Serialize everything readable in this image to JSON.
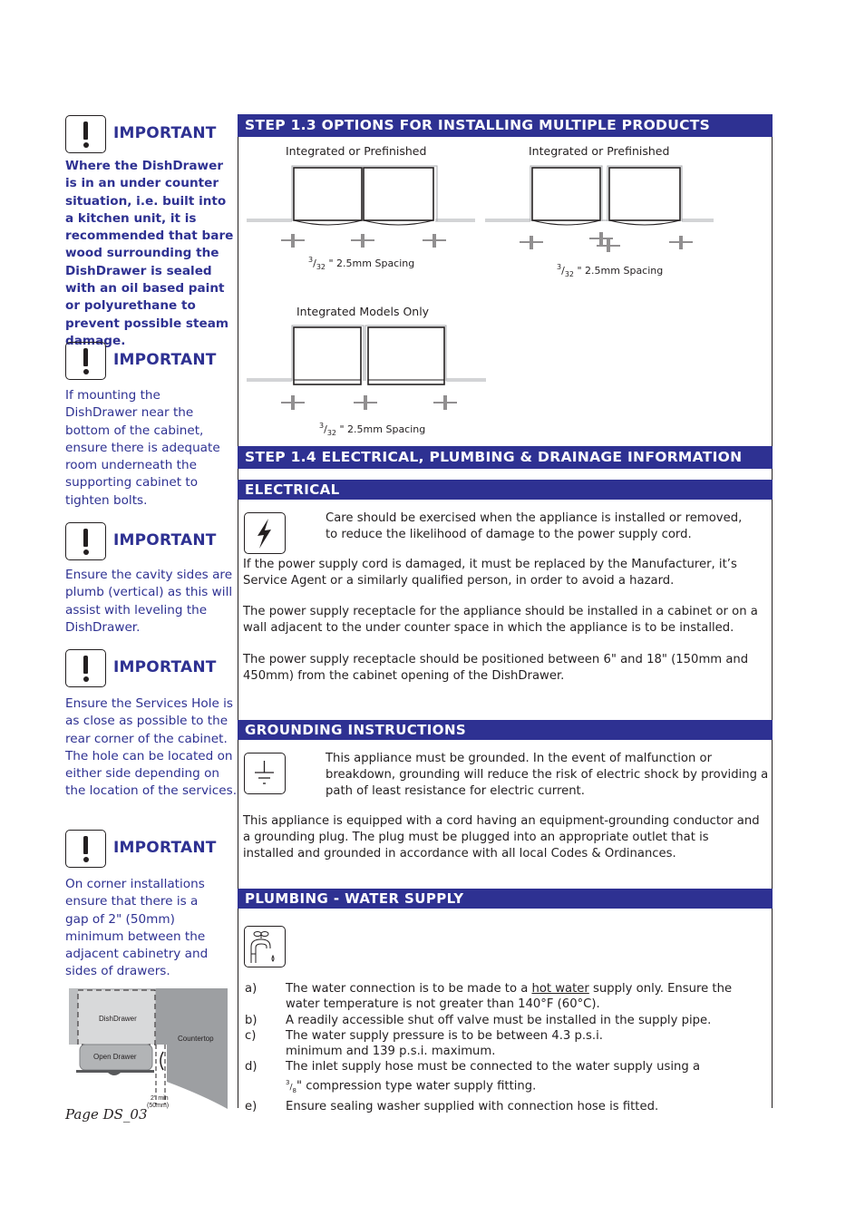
{
  "sidebar": {
    "notes": [
      {
        "title": "IMPORTANT",
        "icon": "exclamation-icon",
        "text": "Where the DishDrawer is in an under counter situation, i.e. built into a kitchen unit, it is recommended that bare wood surrounding the DishDrawer is sealed with an oil based paint or polyurethane to prevent possible steam damage."
      },
      {
        "title": "IMPORTANT",
        "icon": "exclamation-icon",
        "text": "If mounting the DishDrawer near the bottom of the cabinet, ensure there is adequate room underneath the supporting cabinet to tighten bolts."
      },
      {
        "title": "IMPORTANT",
        "icon": "exclamation-icon",
        "text": "Ensure the cavity sides are plumb (vertical) as this will assist with leveling the DishDrawer."
      },
      {
        "title": "IMPORTANT",
        "icon": "exclamation-icon",
        "text": "Ensure the Services Hole is as close as possible to the rear corner of the cabinet. The hole can be located on either side depending on the location of the services."
      },
      {
        "title": "IMPORTANT",
        "icon": "exclamation-icon",
        "text": "On corner installations ensure that there is a gap of 2\" (50mm) minimum between the adjacent cabinetry and sides of drawers."
      }
    ],
    "corner_diagram": {
      "dishdrawer_label": "DishDrawer",
      "countertop_label": "Countertop",
      "open_drawer_label": "Open Drawer",
      "gap_label_1": "2\" min",
      "gap_label_2": "(50mm)"
    },
    "page_number": "Page DS_03"
  },
  "step13": {
    "heading": "STEP  1.3  OPTIONS FOR INSTALLING MULTIPLE PRODUCTS",
    "diagrams": [
      {
        "label": "Integrated or Prefinished",
        "spacing_num": "3",
        "spacing_den": "32",
        "spacing_text": " \" 2.5mm Spacing"
      },
      {
        "label": "Integrated or Prefinished",
        "spacing_num": "3",
        "spacing_den": "32",
        "spacing_text": " \" 2.5mm Spacing"
      },
      {
        "label": "Integrated Models Only",
        "spacing_num": "3",
        "spacing_den": "32",
        "spacing_text": " \" 2.5mm Spacing"
      }
    ]
  },
  "step14": {
    "heading": "STEP  1.4  ELECTRICAL, PLUMBING & DRAINAGE INFORMATION",
    "electrical": {
      "heading": "ELECTRICAL",
      "icon": "lightning-icon",
      "intro": "Care should be exercised when the appliance is installed or removed, to reduce the likelihood of damage to the power supply cord.",
      "paragraphs": [
        "If the power supply cord is damaged, it must be replaced by the Manufacturer, it’s Service Agent or a similarly qualified person, in order to avoid a hazard.",
        "The power supply receptacle for the appliance should be installed in a cabinet or on a wall adjacent to the under counter space in which the appliance is to be installed.",
        "The power supply receptacle should be positioned between 6\" and 18\" (150mm and 450mm) from the cabinet opening of the DishDrawer."
      ]
    },
    "grounding": {
      "heading": "GROUNDING  INSTRUCTIONS",
      "icon": "ground-icon",
      "intro": "This appliance must be grounded.  In the event of malfunction or breakdown, grounding will reduce the risk of electric shock by providing a path of least resistance for electric current.",
      "paragraph": "This appliance is equipped with a cord having an equipment-grounding conductor and a grounding plug.  The plug must be plugged into an appropriate outlet that is installed and grounded in accordance with all local Codes & Ordinances."
    },
    "plumbing": {
      "heading": "PLUMBING  -  WATER  SUPPLY",
      "icon": "faucet-icon",
      "items": [
        {
          "marker": "a)",
          "pre": "The water connection is to be made to a ",
          "underlined": "hot water",
          "post": " supply only.  Ensure the water temperature is not greater than 140°F (60°C)."
        },
        {
          "marker": "b)",
          "text": "A readily accessible shut off valve must be installed in the supply pipe."
        },
        {
          "marker": "c)",
          "text": "The water supply pressure is to be between 4.3 p.s.i.  minimum and 139 p.s.i. maximum."
        },
        {
          "marker": "d)",
          "pre": "The inlet supply hose must be connected to the water supply using a ",
          "frac_num": "3",
          "frac_den": "8",
          "post": "\" compression type water supply fitting."
        },
        {
          "marker": "e)",
          "text": "Ensure sealing washer supplied with connection hose is fitted."
        }
      ]
    }
  },
  "colors": {
    "brand_blue": "#2e3192",
    "text": "#231f20",
    "diagram_gray": "#a7a9ac"
  }
}
